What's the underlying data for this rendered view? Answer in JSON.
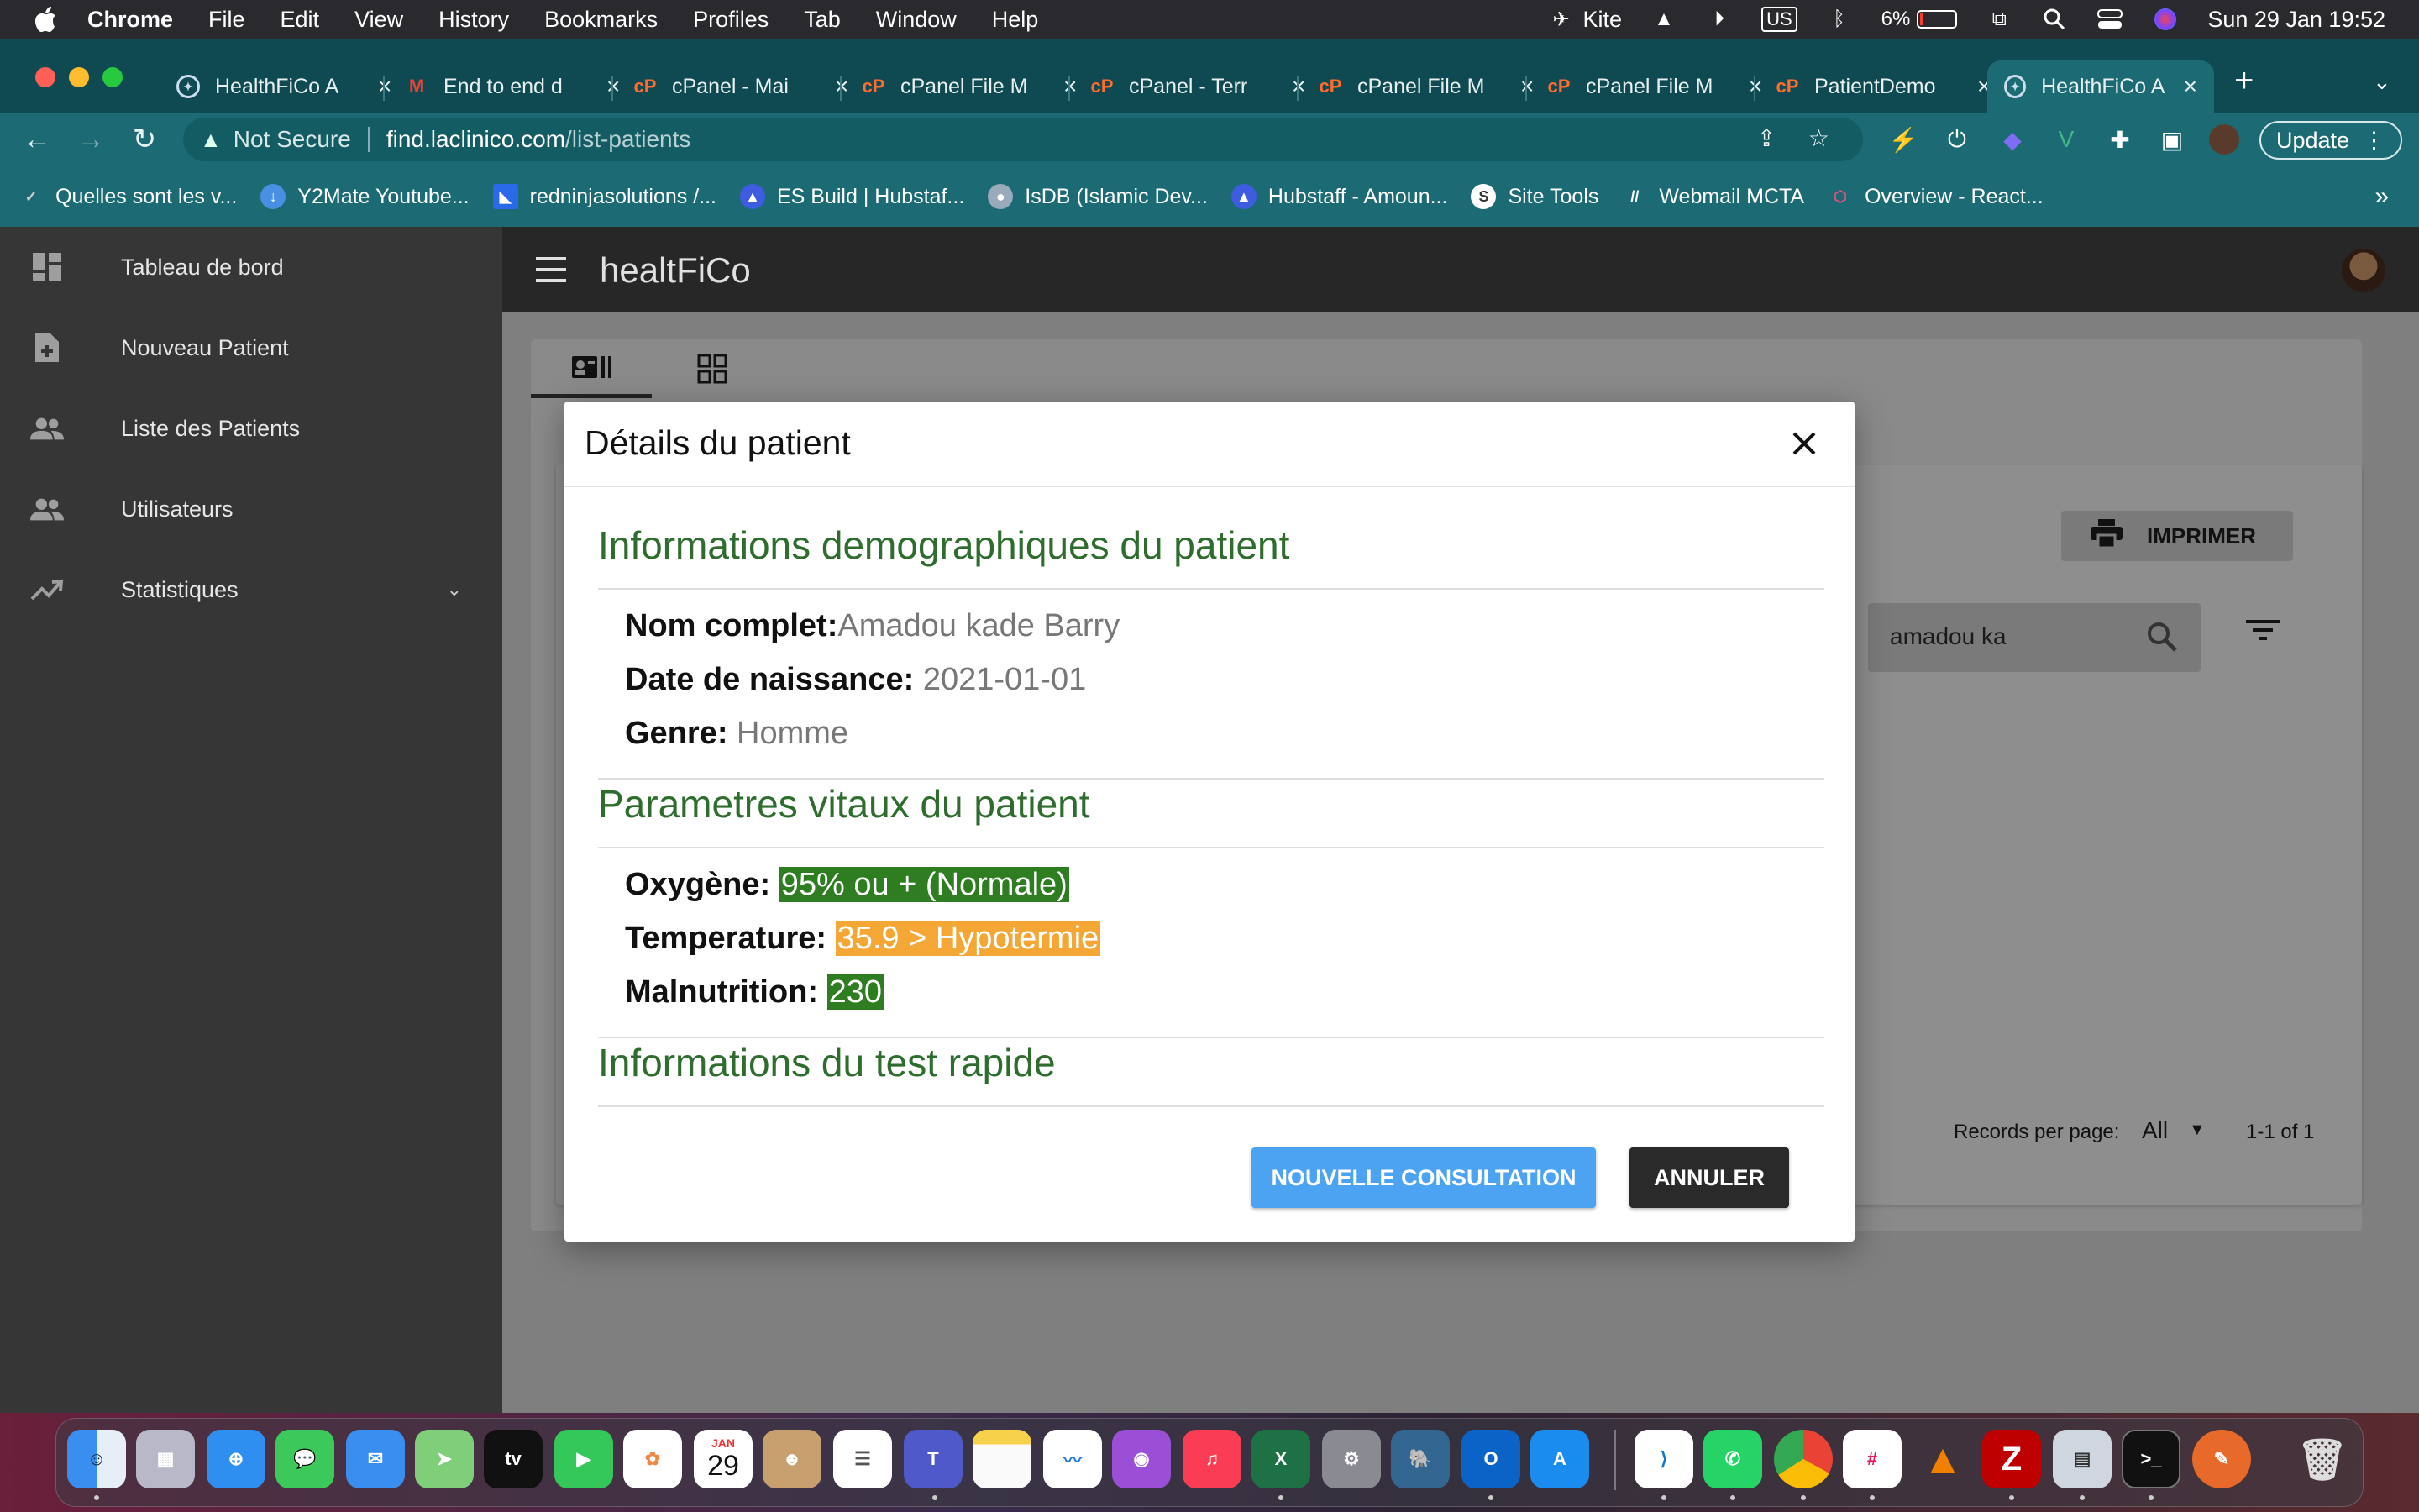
{
  "menubar": {
    "app_name": "Chrome",
    "items": [
      "File",
      "Edit",
      "View",
      "History",
      "Bookmarks",
      "Profiles",
      "Tab",
      "Window",
      "Help"
    ],
    "kite": "Kite",
    "keyboard": "US",
    "battery": "6%",
    "datetime": "Sun 29 Jan  19:52"
  },
  "tabs": [
    {
      "title": "HealthFiCo A",
      "favicon": "healthfico-icon"
    },
    {
      "title": "End to end d",
      "favicon": "gmail-icon"
    },
    {
      "title": "cPanel - Mai",
      "favicon": "cpanel-icon"
    },
    {
      "title": "cPanel File M",
      "favicon": "cpanel-icon"
    },
    {
      "title": "cPanel - Terr",
      "favicon": "cpanel-icon"
    },
    {
      "title": "cPanel File M",
      "favicon": "cpanel-icon"
    },
    {
      "title": "cPanel File M",
      "favicon": "cpanel-icon"
    },
    {
      "title": "PatientDemo",
      "favicon": "cpanel-icon"
    },
    {
      "title": "HealthFiCo A",
      "favicon": "healthfico-icon",
      "active": true
    }
  ],
  "address": {
    "security": "Not Secure",
    "host": "find.laclinico.com",
    "path": "/list-patients"
  },
  "update_label": "Update",
  "bookmarks": [
    "Quelles sont les v...",
    "Y2Mate Youtube...",
    "redninjasolutions /...",
    "ES Build | Hubstaf...",
    "IsDB (Islamic Dev...",
    "Hubstaff - Amoun...",
    "Site Tools",
    "Webmail MCTA",
    "Overview - React..."
  ],
  "sidebar": {
    "items": [
      {
        "label": "Tableau de bord",
        "icon": "dashboard-icon"
      },
      {
        "label": "Nouveau Patient",
        "icon": "new-document-icon"
      },
      {
        "label": "Liste des Patients",
        "icon": "people-icon"
      },
      {
        "label": "Utilisateurs",
        "icon": "people-icon"
      },
      {
        "label": "Statistiques",
        "icon": "trending-up-icon"
      }
    ]
  },
  "app": {
    "title": "healtFiCo"
  },
  "list": {
    "print_label": "IMPRIMER",
    "search_value": "amadou ka",
    "records_per_page_label": "Records per page:",
    "records_per_page_value": "All",
    "pagination": "1-1 of 1"
  },
  "dialog": {
    "title": "Détails du patient",
    "section_demo": "Informations demographiques du patient",
    "name_label": "Nom complet:",
    "name_value": "Amadou kade Barry",
    "dob_label": "Date de naissance:",
    "dob_value": "2021-01-01",
    "gender_label": "Genre:",
    "gender_value": "Homme",
    "section_vitals": "Parametres vitaux du patient",
    "oxygen_label": "Oxygène:",
    "oxygen_value": "95% ou + (Normale)",
    "temp_label": "Temperature:",
    "temp_value": "35.9 > Hypotermie",
    "malnutrition_label": "Malnutrition:",
    "malnutrition_value": "230",
    "section_test": "Informations du test rapide",
    "btn_consult": "NOUVELLE CONSULTATION",
    "btn_cancel": "ANNULER"
  },
  "colors": {
    "section_green": "#2e6d2e",
    "badge_green": "#2e7d20",
    "badge_orange": "#f4a734",
    "primary_blue": "#4ba3f2",
    "chrome_teal": "#1c6b74"
  },
  "calendar": {
    "month": "JAN",
    "day": "29"
  }
}
